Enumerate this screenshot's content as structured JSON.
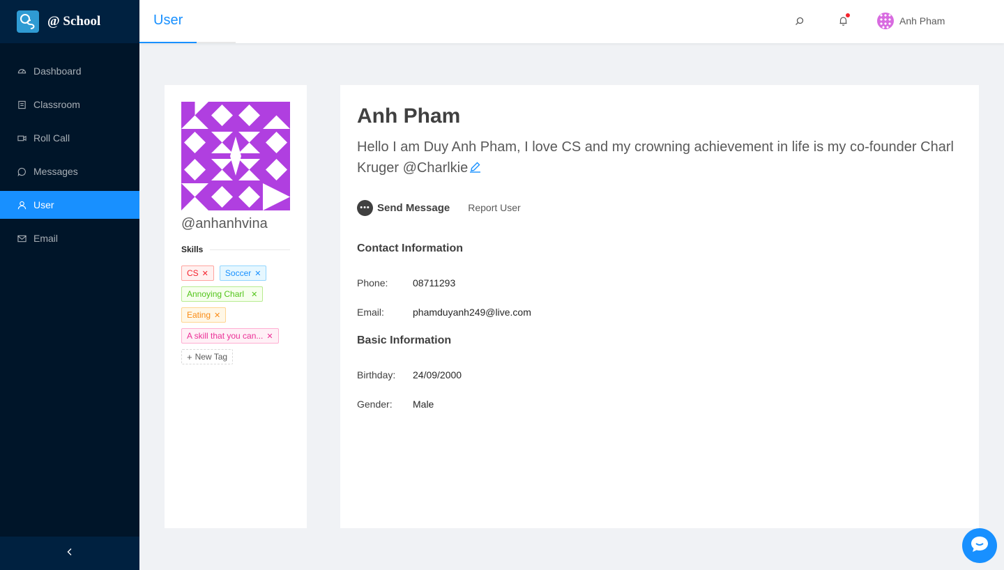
{
  "sidebar": {
    "logo_text": "@ School",
    "items": [
      {
        "label": "Dashboard",
        "icon": "dashboard-icon",
        "active": false
      },
      {
        "label": "Classroom",
        "icon": "book-icon",
        "active": false
      },
      {
        "label": "Roll Call",
        "icon": "video-camera-icon",
        "active": false
      },
      {
        "label": "Messages",
        "icon": "message-icon",
        "active": false
      },
      {
        "label": "User",
        "icon": "user-icon",
        "active": true
      },
      {
        "label": "Email",
        "icon": "mail-icon",
        "active": false
      }
    ]
  },
  "header": {
    "tab": "User",
    "user_name": "Anh Pham"
  },
  "profile": {
    "handle": "@anhanhvina",
    "skills_label": "Skills",
    "tags": [
      {
        "label": "CS",
        "color": "red"
      },
      {
        "label": "Soccer",
        "color": "blue"
      },
      {
        "label": "Annoying Charl",
        "color": "green"
      },
      {
        "label": "Eating",
        "color": "orange"
      },
      {
        "label": "A skill that you can...",
        "color": "magenta"
      }
    ],
    "new_tag_label": "New Tag",
    "name": "Anh Pham",
    "bio": "Hello I am Duy Anh Pham, I love CS and my crowning achievement in life is my co-founder Charl Kruger @Charlkie",
    "send_message_label": "Send Message",
    "report_label": "Report User"
  },
  "contact": {
    "title": "Contact Information",
    "phone_label": "Phone:",
    "phone": "08711293",
    "email_label": "Email:",
    "email": "phamduyanh249@live.com"
  },
  "basic": {
    "title": "Basic Information",
    "birthday_label": "Birthday:",
    "birthday": "24/09/2000",
    "gender_label": "Gender:",
    "gender": "Male"
  },
  "colors": {
    "sidebar_bg": "#001529",
    "accent": "#1890ff",
    "identicon": "#b03fe0"
  }
}
